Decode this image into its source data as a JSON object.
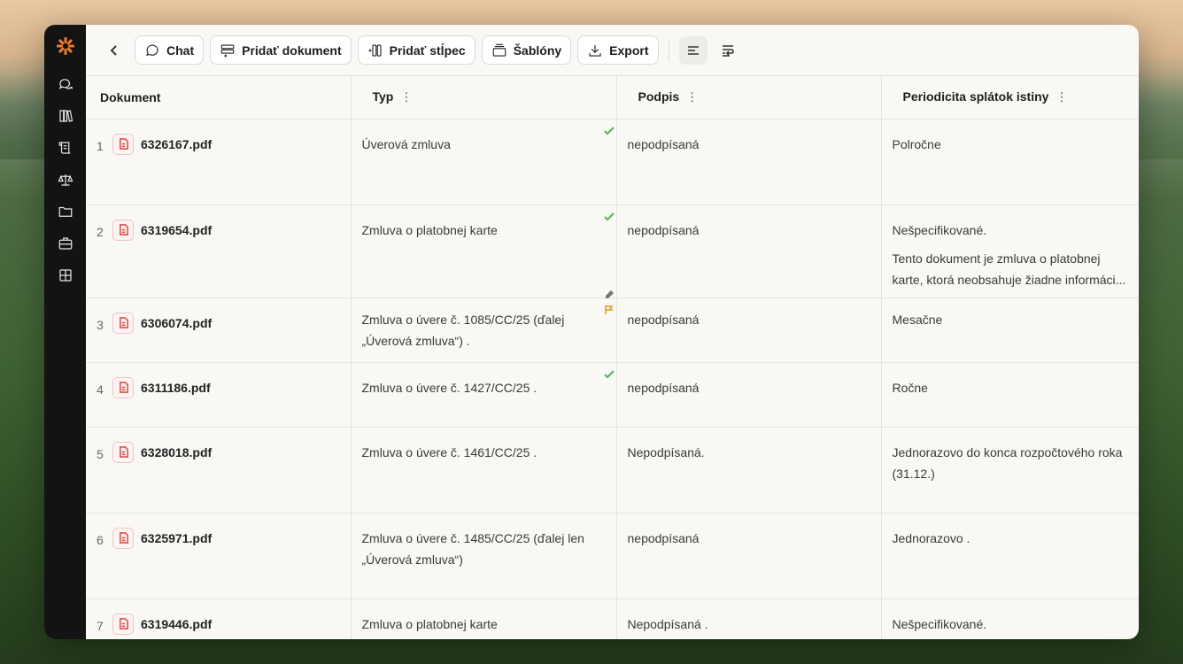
{
  "toolbar": {
    "chat": "Chat",
    "add_document": "Pridať dokument",
    "add_column": "Pridať stĺpec",
    "templates": "Šablóny",
    "export": "Export"
  },
  "columns": [
    "Dokument",
    "Typ",
    "Podpis",
    "Periodicita splátok istiny"
  ],
  "rows": [
    {
      "n": "1",
      "file": "6326167.pdf",
      "typ": "Úverová zmluva",
      "podpis": "nepodpísaná",
      "period": "Polročne",
      "period2": ""
    },
    {
      "n": "2",
      "file": "6319654.pdf",
      "typ": "Zmluva o platobnej karte",
      "podpis": "nepodpísaná",
      "period": "Nešpecifikované.",
      "period2": "Tento dokument je zmluva o platobnej karte, ktorá neobsahuje žiadne informáci..."
    },
    {
      "n": "3",
      "file": "6306074.pdf",
      "typ": "Zmluva o úvere č. 1085/CC/25 (ďalej „Úverová zmluva“) .",
      "podpis": "nepodpísaná",
      "period": "Mesačne",
      "period2": ""
    },
    {
      "n": "4",
      "file": "6311186.pdf",
      "typ": "Zmluva o úvere č. 1427/CC/25 .",
      "podpis": "nepodpísaná",
      "period": "Ročne",
      "period2": ""
    },
    {
      "n": "5",
      "file": "6328018.pdf",
      "typ": "Zmluva o úvere č. 1461/CC/25 .",
      "podpis": "Nepodpísaná.",
      "period": "Jednorazovo do konca rozpočtového roka (31.12.)",
      "period2": ""
    },
    {
      "n": "6",
      "file": "6325971.pdf",
      "typ": "Zmluva o úvere č. 1485/CC/25 (ďalej len „Úverová zmluva“)",
      "podpis": "nepodpísaná",
      "period": "Jednorazovo .",
      "period2": ""
    },
    {
      "n": "7",
      "file": "6319446.pdf",
      "typ": "Zmluva o platobnej karte",
      "podpis": "Nepodpísaná .",
      "period": "Nešpecifikované.",
      "period2": ""
    }
  ]
}
